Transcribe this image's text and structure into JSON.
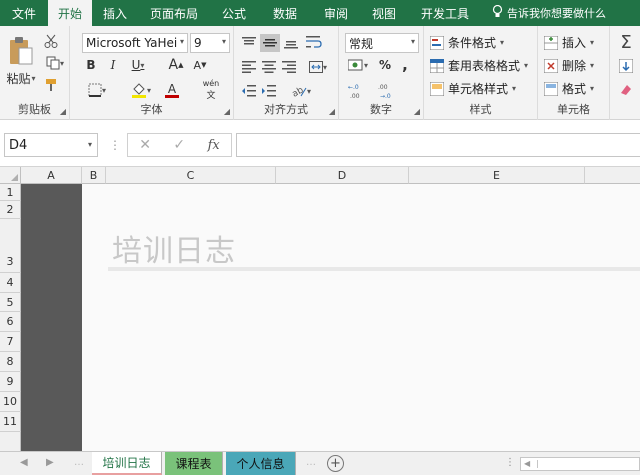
{
  "ribbon_tabs": [
    "文件",
    "开始",
    "插入",
    "页面布局",
    "公式",
    "数据",
    "审阅",
    "视图",
    "开发工具"
  ],
  "active_tab": "开始",
  "tell_me": "告诉我你想要做什么",
  "clipboard": {
    "paste": "粘贴",
    "label": "剪贴板"
  },
  "font": {
    "name": "Microsoft YaHei",
    "size": "9",
    "label": "字体",
    "bold": "B",
    "italic": "I",
    "underline": "U",
    "grow": "A",
    "shrink": "A",
    "color_letter": "A",
    "phonetic": "wén"
  },
  "alignment": {
    "label": "对齐方式"
  },
  "number": {
    "format": "常规",
    "percent": "%",
    "comma": ",",
    "label": "数字"
  },
  "styles": {
    "conditional": "条件格式",
    "table": "套用表格格式",
    "cell_styles": "单元格样式",
    "label": "样式"
  },
  "cells": {
    "insert": "插入",
    "delete": "删除",
    "format": "格式",
    "label": "单元格"
  },
  "formula_bar": {
    "name_box": "D4",
    "cancel": "✕",
    "enter": "✓",
    "fx": "fx",
    "value": ""
  },
  "columns": [
    "A",
    "B",
    "C",
    "D",
    "E"
  ],
  "rows": [
    "1",
    "2",
    "3",
    "4",
    "5",
    "6",
    "7",
    "8",
    "9",
    "10",
    "11"
  ],
  "cell_c3": "培训日志",
  "sheets": [
    "培训日志",
    "课程表",
    "个人信息"
  ],
  "active_sheet": "培训日志",
  "colors": {
    "brand": "#217346",
    "tab_green": "#7ac27a",
    "tab_teal": "#4aa7b8",
    "dark_col": "#595959"
  }
}
